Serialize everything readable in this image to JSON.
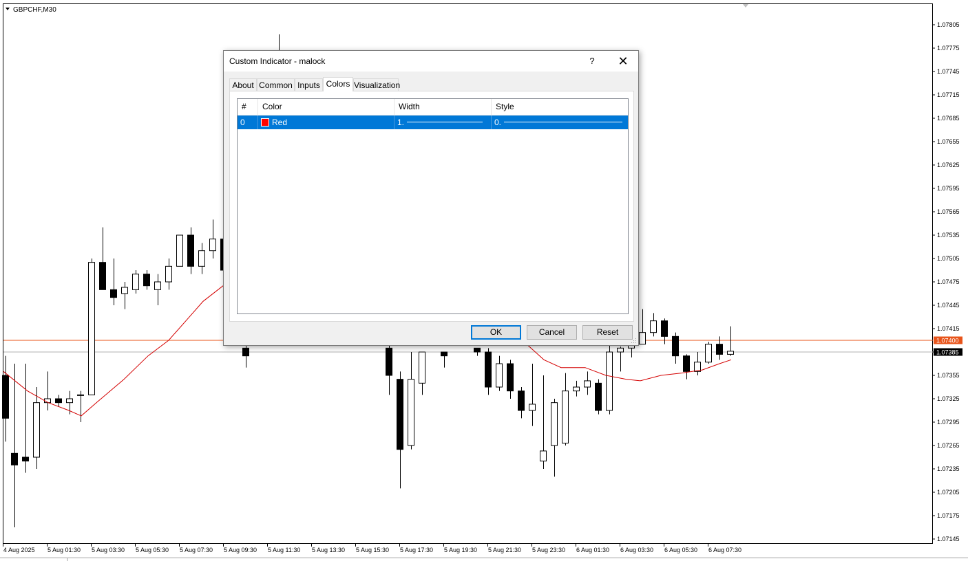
{
  "chart": {
    "symbol_label": "GBPCHF,M30",
    "bullish_color": "#ffffff",
    "bearish_color": "#000000",
    "ma_color": "#d40000",
    "bid_line_color": "#e8541a",
    "price_axis_labels": [
      "1.07805",
      "1.07775",
      "1.07745",
      "1.07715",
      "1.07685",
      "1.07655",
      "1.07625",
      "1.07595",
      "1.07565",
      "1.07535",
      "1.07505",
      "1.07475",
      "1.07445",
      "1.07415",
      "1.07385",
      "1.07355",
      "1.07325",
      "1.07295",
      "1.07265",
      "1.07235",
      "1.07205",
      "1.07175",
      "1.07145"
    ],
    "time_axis_labels": [
      "4 Aug 2025",
      "5 Aug 01:30",
      "5 Aug 03:30",
      "5 Aug 05:30",
      "5 Aug 07:30",
      "5 Aug 09:30",
      "5 Aug 11:30",
      "5 Aug 13:30",
      "5 Aug 15:30",
      "5 Aug 17:30",
      "5 Aug 19:30",
      "5 Aug 21:30",
      "5 Aug 23:30",
      "6 Aug 01:30",
      "6 Aug 03:30",
      "6 Aug 05:30",
      "6 Aug 07:30"
    ],
    "price_markers": [
      {
        "value": "1.07400",
        "color": "#e8541a"
      },
      {
        "value": "1.07385",
        "color": "#000000"
      }
    ]
  },
  "dialog": {
    "title": "Custom Indicator - malock",
    "help_label": "?",
    "close_label": "✕",
    "tabs": [
      "About",
      "Common",
      "Inputs",
      "Colors",
      "Visualization"
    ],
    "active_tab": "Colors",
    "grid": {
      "headers": [
        "#",
        "Color",
        "Width",
        "Style"
      ],
      "rows": [
        {
          "index": "0",
          "color_name": "Red",
          "color_hex": "#ff0000",
          "width": "1.",
          "style": "0."
        }
      ]
    },
    "buttons": {
      "ok": "OK",
      "cancel": "Cancel",
      "reset": "Reset"
    }
  }
}
